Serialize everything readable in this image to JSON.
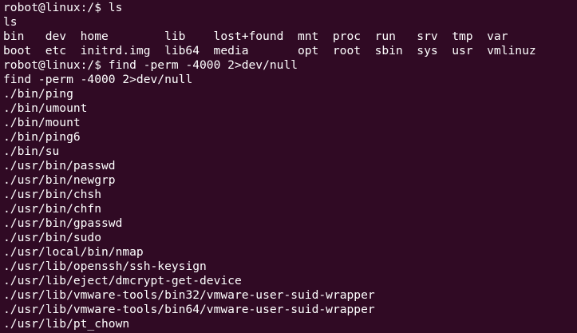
{
  "colors": {
    "background": "#300a24",
    "foreground": "#ffffff"
  },
  "lines": [
    {
      "type": "prompt",
      "prompt": "robot@linux:/$",
      "command": " ls"
    },
    {
      "type": "output",
      "text": "ls"
    },
    {
      "type": "ls",
      "cells": [
        "bin",
        "dev",
        "home",
        "lib",
        "lost+found",
        "mnt",
        "proc",
        "run",
        "srv",
        "tmp",
        "var"
      ]
    },
    {
      "type": "ls",
      "cells": [
        "boot",
        "etc",
        "initrd.img",
        "lib64",
        "media",
        "opt",
        "root",
        "sbin",
        "sys",
        "usr",
        "vmlinuz"
      ]
    },
    {
      "type": "prompt",
      "prompt": "robot@linux:/$",
      "command": " find -perm -4000 2>dev/null"
    },
    {
      "type": "output",
      "text": "find -perm -4000 2>dev/null"
    },
    {
      "type": "output",
      "text": "./bin/ping"
    },
    {
      "type": "output",
      "text": "./bin/umount"
    },
    {
      "type": "output",
      "text": "./bin/mount"
    },
    {
      "type": "output",
      "text": "./bin/ping6"
    },
    {
      "type": "output",
      "text": "./bin/su"
    },
    {
      "type": "output",
      "text": "./usr/bin/passwd"
    },
    {
      "type": "output",
      "text": "./usr/bin/newgrp"
    },
    {
      "type": "output",
      "text": "./usr/bin/chsh"
    },
    {
      "type": "output",
      "text": "./usr/bin/chfn"
    },
    {
      "type": "output",
      "text": "./usr/bin/gpasswd"
    },
    {
      "type": "output",
      "text": "./usr/bin/sudo"
    },
    {
      "type": "output",
      "text": "./usr/local/bin/nmap"
    },
    {
      "type": "output",
      "text": "./usr/lib/openssh/ssh-keysign"
    },
    {
      "type": "output",
      "text": "./usr/lib/eject/dmcrypt-get-device"
    },
    {
      "type": "output",
      "text": "./usr/lib/vmware-tools/bin32/vmware-user-suid-wrapper"
    },
    {
      "type": "output",
      "text": "./usr/lib/vmware-tools/bin64/vmware-user-suid-wrapper"
    },
    {
      "type": "output",
      "text": "./usr/lib/pt_chown"
    }
  ]
}
